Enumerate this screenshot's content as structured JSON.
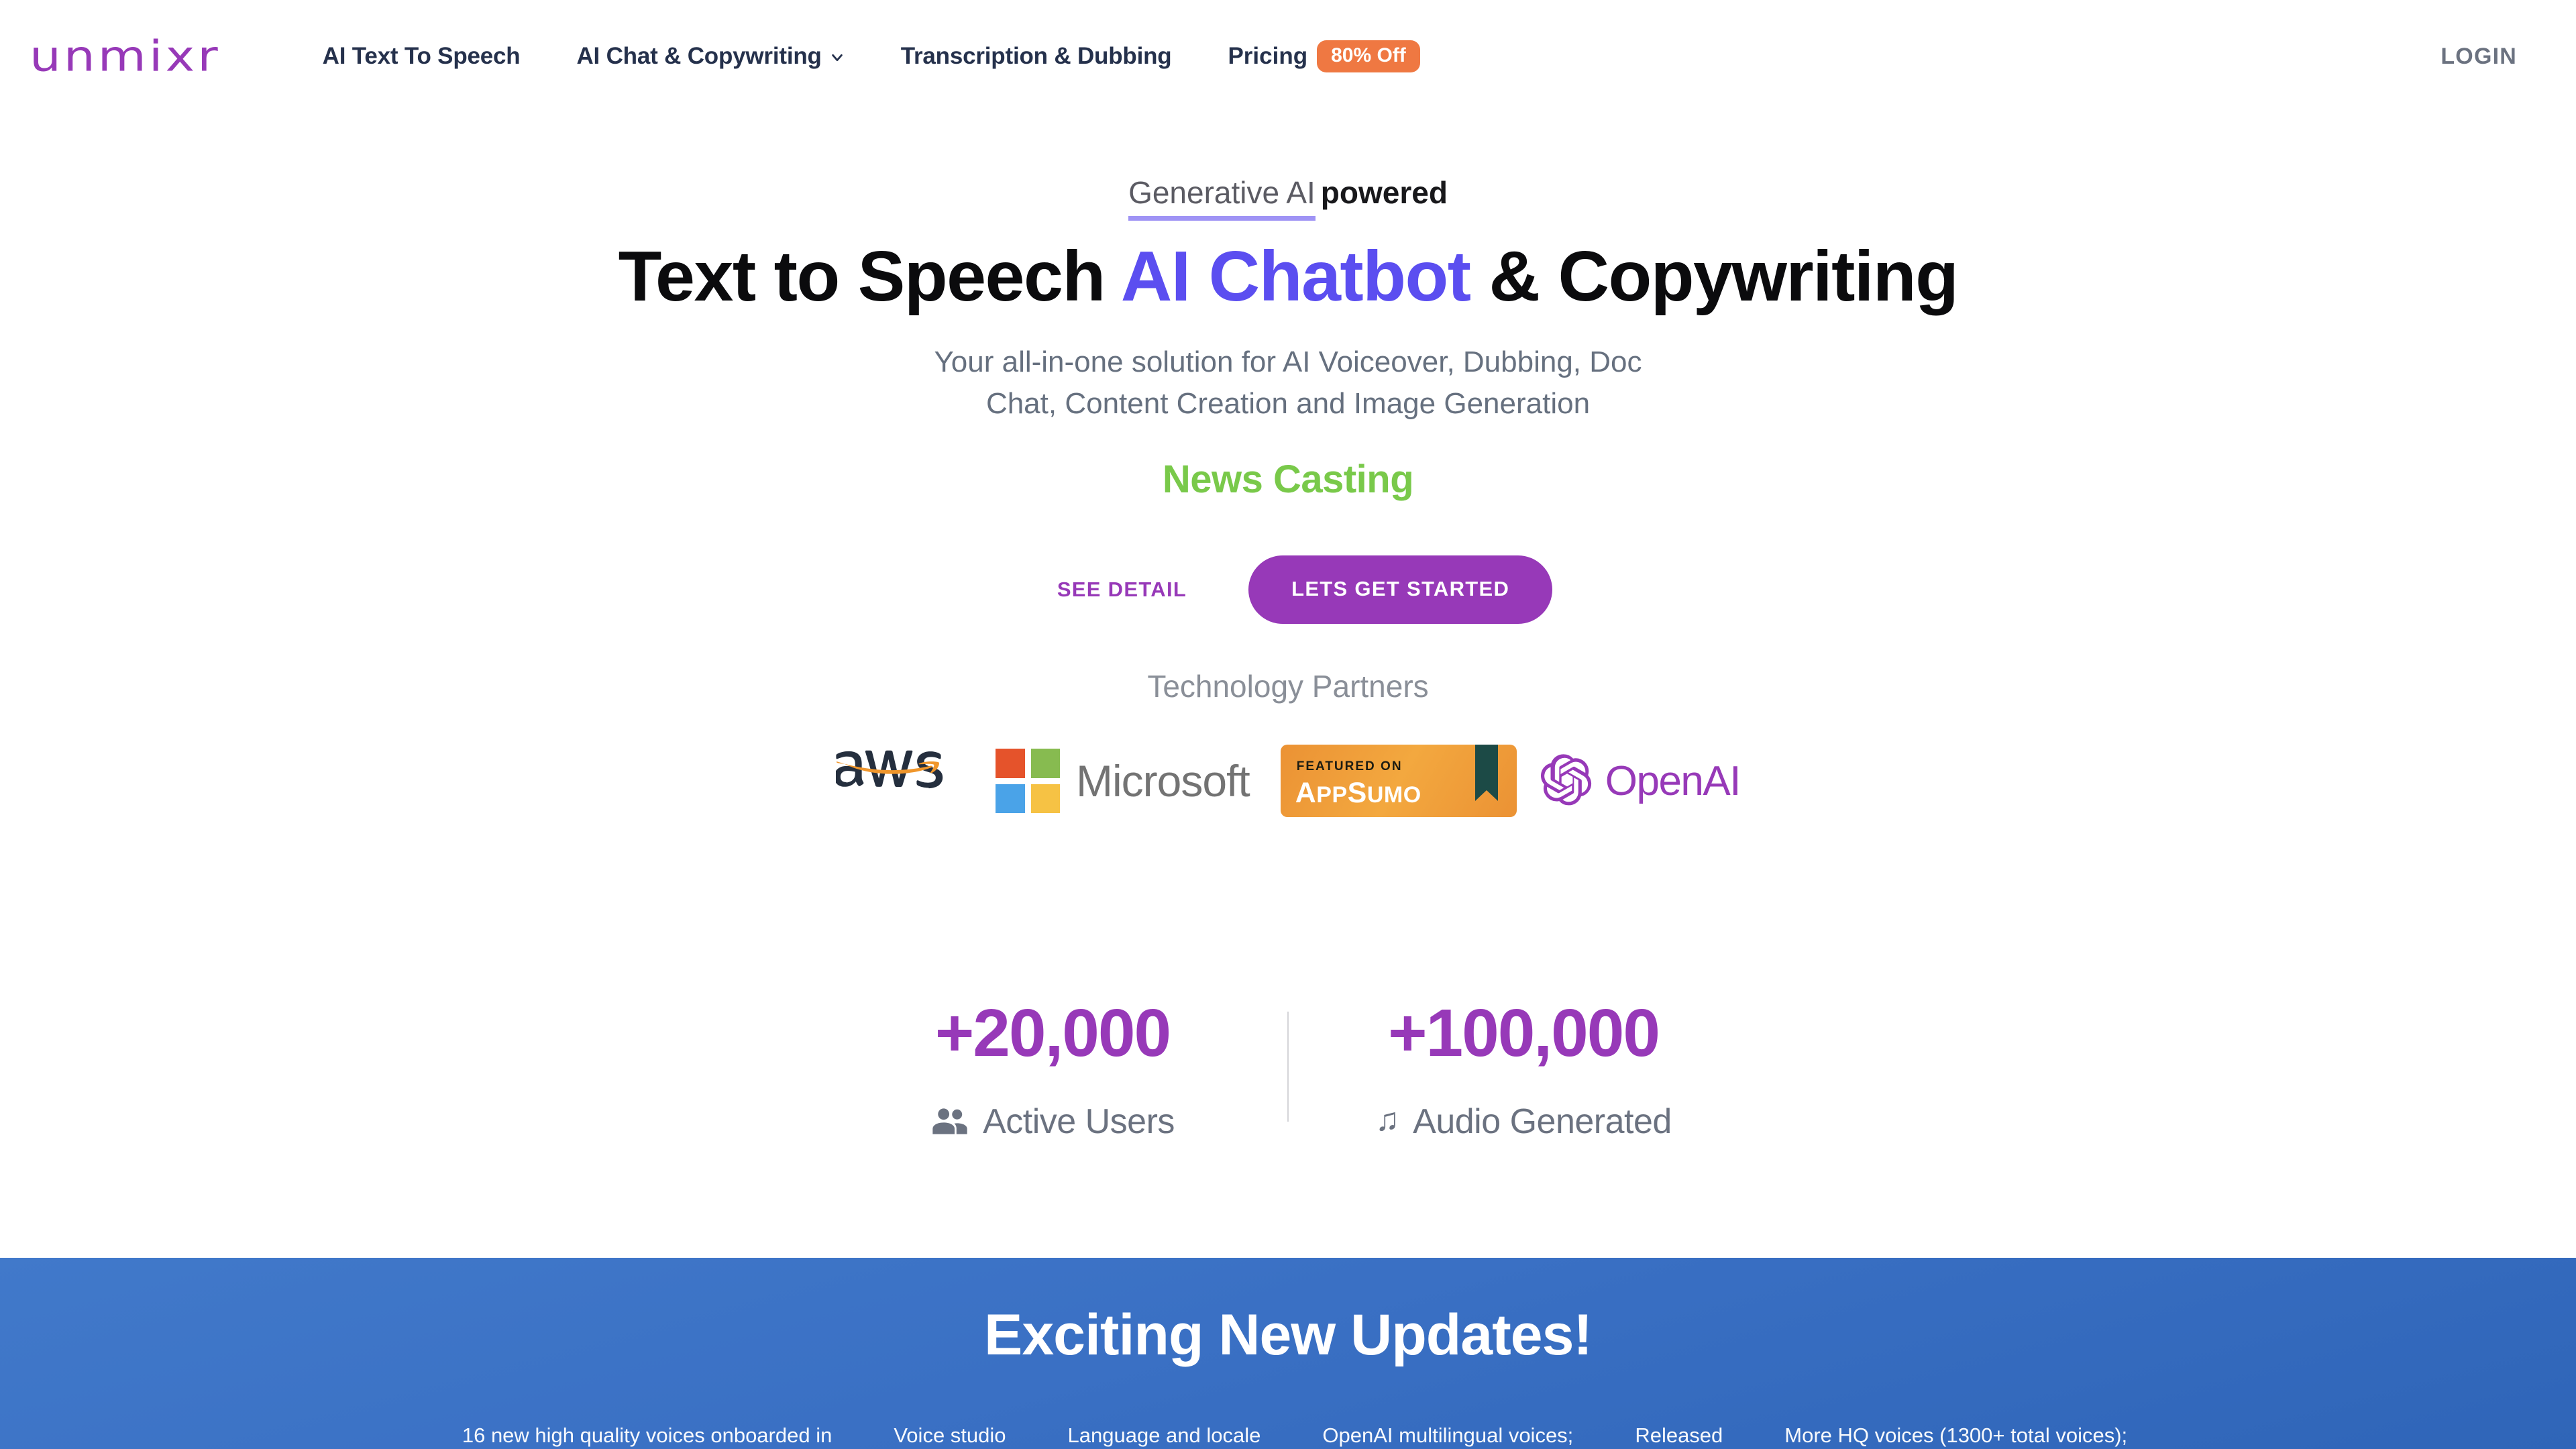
{
  "brand": {
    "logo_text": "unmixr",
    "logo_color": "#9739b8"
  },
  "nav": {
    "items": [
      {
        "label": "AI Text To Speech",
        "has_caret": false
      },
      {
        "label": "AI Chat & Copywriting",
        "has_caret": true
      },
      {
        "label": "Transcription & Dubbing",
        "has_caret": false
      }
    ],
    "pricing": {
      "label": "Pricing",
      "badge": "80% Off",
      "badge_color": "#ef7842"
    },
    "login_label": "LOGIN"
  },
  "hero": {
    "eyebrow_underlined": "Generative AI",
    "eyebrow_bold": "powered",
    "headline_part1": "Text to Speech ",
    "headline_accent": "AI Chatbot",
    "headline_part2": " & Copywriting",
    "headline_accent_color": "#5b4ef0",
    "subtitle_line1": "Your all-in-one solution for AI Voiceover, Dubbing, Doc",
    "subtitle_line2": "Chat, Content Creation and Image Generation",
    "rotating_feature": "News Casting",
    "rotating_feature_color": "#79c94a",
    "secondary_cta": "SEE DETAIL",
    "primary_cta": "LETS GET STARTED",
    "primary_cta_color": "#9739b8"
  },
  "partners": {
    "title": "Technology Partners",
    "logos": [
      {
        "name": "aws",
        "text": "aws"
      },
      {
        "name": "microsoft",
        "text": "Microsoft"
      },
      {
        "name": "appsumo",
        "featured_label": "FEATURED ON",
        "text": "AppSumo"
      },
      {
        "name": "openai",
        "text": "OpenAI"
      }
    ]
  },
  "stats": [
    {
      "value": "+20,000",
      "label": "Active Users",
      "icon": "people-icon"
    },
    {
      "value": "+100,000",
      "label": "Audio Generated",
      "icon": "music-note-icon",
      "icon_glyph": "♫"
    }
  ],
  "updates": {
    "title": "Exciting New Updates!",
    "ticker_items": [
      "16 new high quality voices onboarded in",
      "Voice studio",
      "Language and locale",
      "OpenAI multilingual voices;",
      "Released",
      "More HQ voices (1300+ total voices);"
    ]
  }
}
